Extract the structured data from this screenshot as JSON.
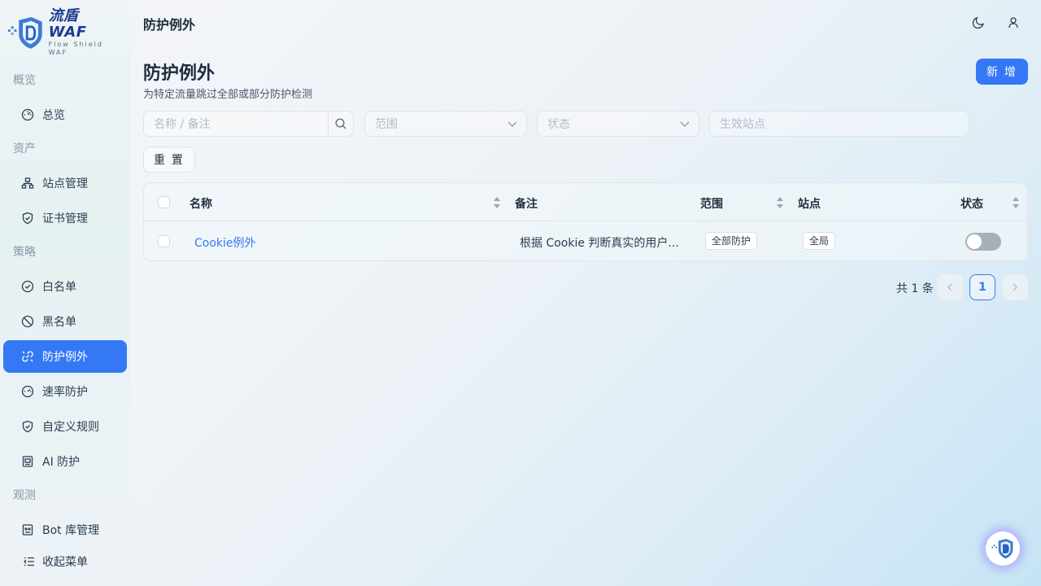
{
  "logo": {
    "title": "流盾 WAF",
    "subtitle": "Flow Shield WAF"
  },
  "header": {
    "title": "防护例外"
  },
  "sidebar": {
    "groups": [
      {
        "label": "概览",
        "items": [
          {
            "label": "总览",
            "icon": "dashboard-icon"
          }
        ]
      },
      {
        "label": "资产",
        "items": [
          {
            "label": "站点管理",
            "icon": "sitemap-icon"
          },
          {
            "label": "证书管理",
            "icon": "shield-check-icon"
          }
        ]
      },
      {
        "label": "策略",
        "items": [
          {
            "label": "白名单",
            "icon": "check-circle-icon"
          },
          {
            "label": "黑名单",
            "icon": "ban-icon"
          },
          {
            "label": "防护例外",
            "icon": "link-off-icon",
            "active": true
          },
          {
            "label": "速率防护",
            "icon": "speedometer-icon"
          },
          {
            "label": "自定义规则",
            "icon": "shield-check-icon"
          },
          {
            "label": "AI 防护",
            "icon": "robot-icon"
          }
        ]
      },
      {
        "label": "观测",
        "items": [
          {
            "label": "Bot 库管理",
            "icon": "robot-icon"
          }
        ]
      }
    ],
    "collapse_label": "收起菜单"
  },
  "page": {
    "title": "防护例外",
    "subtitle": "为特定流量跳过全部或部分防护检测",
    "add_label": "新 增"
  },
  "filters": {
    "search_placeholder": "名称 / 备注",
    "scope_placeholder": "范围",
    "status_placeholder": "状态",
    "site_placeholder": "生效站点",
    "reset_label": "重 置"
  },
  "table": {
    "columns": {
      "name": "名称",
      "remark": "备注",
      "scope": "范围",
      "site": "站点",
      "status": "状态"
    },
    "rows": [
      {
        "name": "Cookie例外",
        "remark": "根据 Cookie 判断真实的用户...",
        "scope": "全部防护",
        "site": "全局",
        "enabled": false
      }
    ]
  },
  "pagination": {
    "total": "共 1 条",
    "current": "1"
  },
  "colors": {
    "accent": "#3478f6",
    "switch_off": "#a9afb7"
  }
}
